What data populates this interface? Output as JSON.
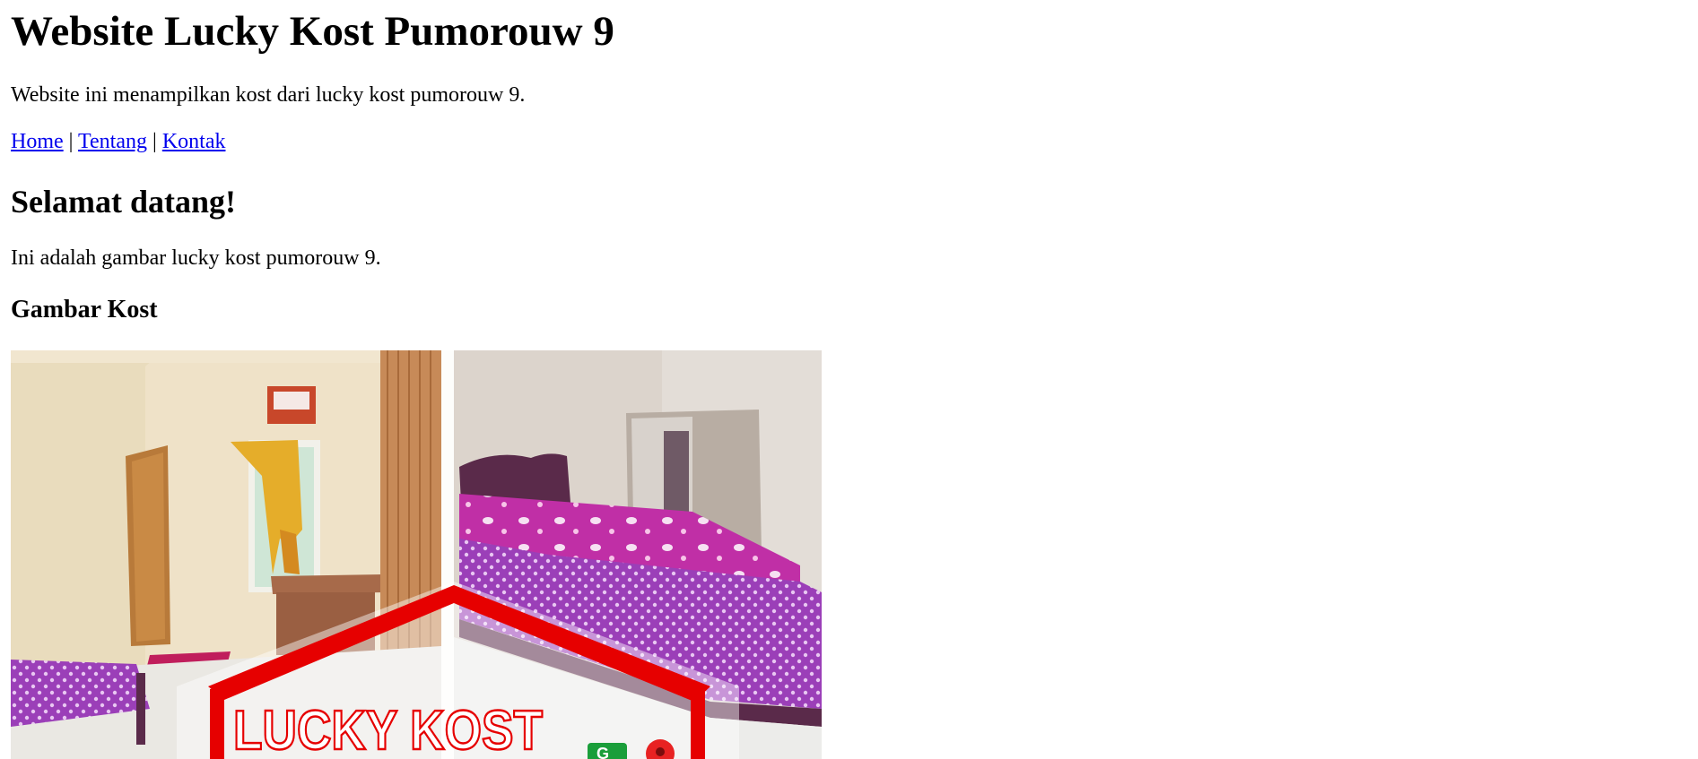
{
  "header": {
    "title": "Website Lucky Kost Pumorouw 9",
    "intro": "Website ini menampilkan kost dari lucky kost pumorouw 9."
  },
  "nav": {
    "items": [
      {
        "label": "Home"
      },
      {
        "label": "Tentang"
      },
      {
        "label": "Kontak"
      }
    ],
    "separator": "|",
    "link_color": "#0000ee"
  },
  "main": {
    "welcome": "Selamat datang!",
    "description": "Ini adalah gambar lucky kost pumorouw 9.",
    "gallery_title": "Gambar Kost",
    "image": {
      "logo_text": "LUCKY KOST",
      "logo_color": "#e60000",
      "bedsheet_color": "#c02fa6"
    }
  }
}
